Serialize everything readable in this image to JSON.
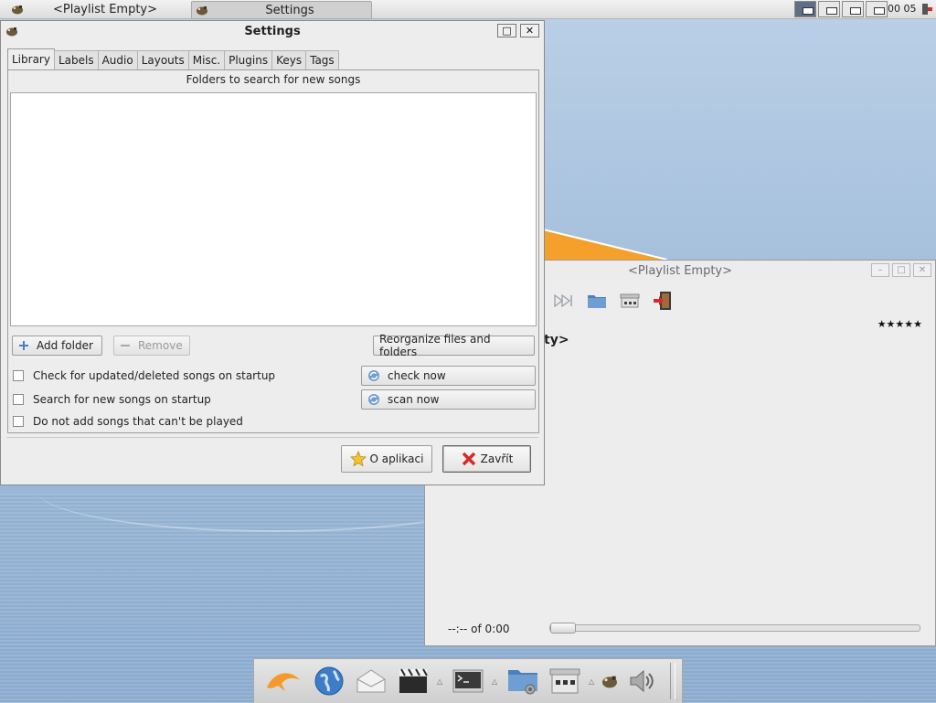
{
  "taskbar": {
    "tasks": [
      {
        "label": "<Playlist Empty>"
      },
      {
        "label": "Settings"
      }
    ],
    "clock": "00 05"
  },
  "playlist_window": {
    "title": "<Playlist Empty>",
    "song_title_partial": "pty>",
    "rating_stars": "★★★★★",
    "time_label": "--:-- of 0:00",
    "icons": [
      "next-track-icon",
      "open-folder-icon",
      "library-icon",
      "quit-icon"
    ]
  },
  "settings_window": {
    "title": "Settings",
    "tabs": [
      {
        "label": "Library",
        "selected": true
      },
      {
        "label": "Labels"
      },
      {
        "label": "Audio"
      },
      {
        "label": "Layouts"
      },
      {
        "label": "Misc."
      },
      {
        "label": "Plugins"
      },
      {
        "label": "Keys"
      },
      {
        "label": "Tags"
      }
    ],
    "library": {
      "header": "Folders to search for new songs",
      "folders": [],
      "add_folder": "Add folder",
      "remove": "Remove",
      "reorganize": "Reorganize files and folders",
      "check_startup": "Check for updated/deleted songs on startup",
      "search_startup": "Search for new songs on startup",
      "no_unplayable": "Do not add songs that can't be played",
      "check_now": "check now",
      "scan_now": "scan now"
    },
    "about_button": "O aplikaci",
    "close_button": "Zavřít"
  },
  "colors": {
    "desktop": "#a9c3de",
    "window_bg": "#ededed",
    "accent_close": "#d62a2a",
    "wallpaper_orange": "#f5a02a"
  }
}
